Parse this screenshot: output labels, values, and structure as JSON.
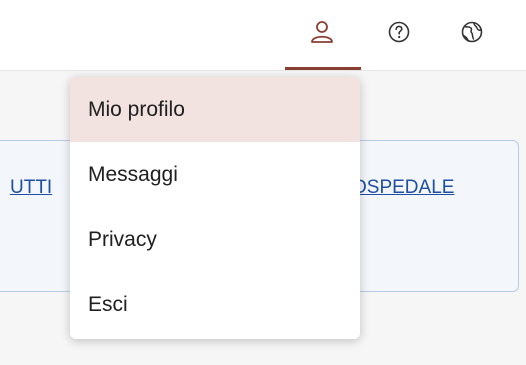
{
  "topbar": {
    "icons": {
      "user": "user-icon",
      "help": "help-icon",
      "language": "globe-icon"
    },
    "accent_color": "#8a3f33"
  },
  "card": {
    "link_left": "UTTI",
    "link_right": "OSPEDALE"
  },
  "menu": {
    "items": [
      {
        "label": "Mio profilo",
        "active": true
      },
      {
        "label": "Messaggi"
      },
      {
        "label": "Privacy"
      },
      {
        "label": "Esci"
      }
    ]
  }
}
